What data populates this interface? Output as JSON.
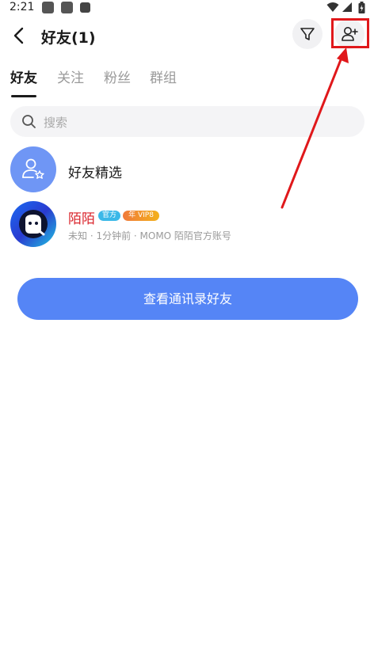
{
  "status_bar": {
    "time": "2:21",
    "icons": [
      "app-notification-icon",
      "app-notification-icon",
      "font-a-icon",
      "wifi-icon",
      "cellular-signal-icon",
      "battery-charging-icon"
    ]
  },
  "header": {
    "title": "好友(1)",
    "back_icon": "chevron-left-icon",
    "filter_icon": "filter-icon",
    "add_friend_icon": "add-user-icon"
  },
  "tabs": [
    {
      "label": "好友",
      "active": true
    },
    {
      "label": "关注",
      "active": false
    },
    {
      "label": "粉丝",
      "active": false
    },
    {
      "label": "群组",
      "active": false
    }
  ],
  "search": {
    "placeholder": "搜索"
  },
  "list": {
    "featured": {
      "label": "好友精选",
      "icon": "user-star-icon"
    },
    "friends": [
      {
        "name": "陌陌",
        "badge_official": "官方",
        "badge_year": "年",
        "badge_vip": "VIP8",
        "subtitle": "未知 · 1分钟前 · MOMO 陌陌官方账号"
      }
    ]
  },
  "actions": {
    "view_contacts": "查看通讯录好友"
  },
  "colors": {
    "accent_blue": "#5585f6",
    "avatar_blue": "#6f96f5",
    "name_red": "#d9232a",
    "highlight_red": "#e0181b"
  }
}
